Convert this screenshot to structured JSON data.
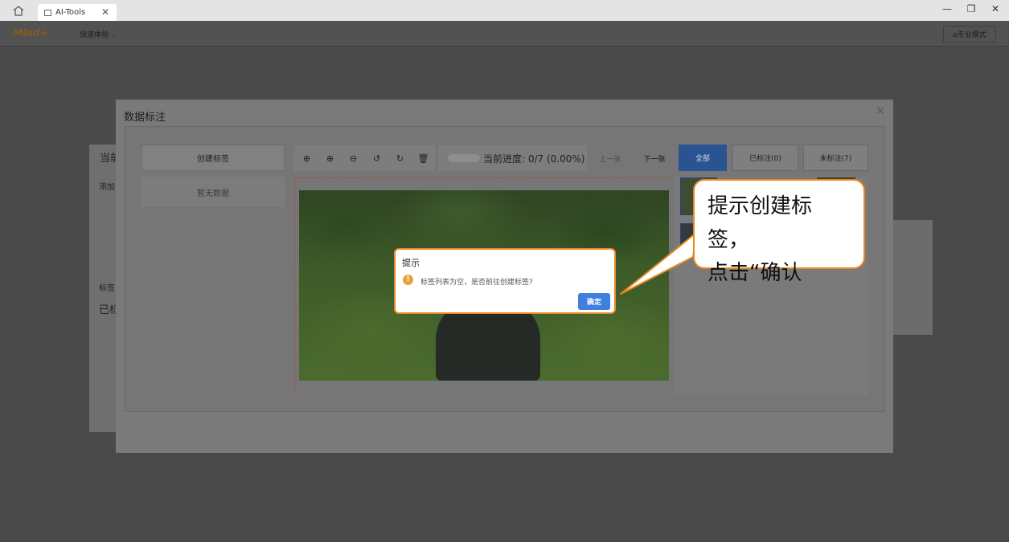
{
  "window": {
    "tab_title": "AI-Tools",
    "tab_close": "✕",
    "home": "⌂",
    "minimize": "—",
    "restore": "❐",
    "close": "✕"
  },
  "appbar": {
    "logo": "Mind+",
    "quick_menu": "快速体验 ⌵",
    "pro_mode": "⌂专业模式"
  },
  "background": {
    "label1": "当前",
    "label2": "添加",
    "label3": "标签",
    "label4": "已标"
  },
  "dialog": {
    "title": "数据标注",
    "close": "×",
    "create_label": "创建标签",
    "no_data": "暂无数据",
    "progress_label": "当前进度: 0/7 (0.00%)",
    "prev": "上一张",
    "next": "下一张",
    "filter_all": "全部",
    "filter_done": "已标注(0)",
    "filter_todo": "未标注(7)",
    "tools": [
      "⊕",
      "⊕",
      "⊖",
      "↺",
      "↻",
      "🗑"
    ]
  },
  "alert": {
    "title": "提示",
    "icon": "!",
    "message": "标签列表为空，是否前往创建标签?",
    "ok": "确定"
  },
  "callout": {
    "line1": "提示创建标签，",
    "line2": "点击“确认"
  },
  "colors": {
    "accent": "#e88a22",
    "primary": "#3f7fe0"
  }
}
